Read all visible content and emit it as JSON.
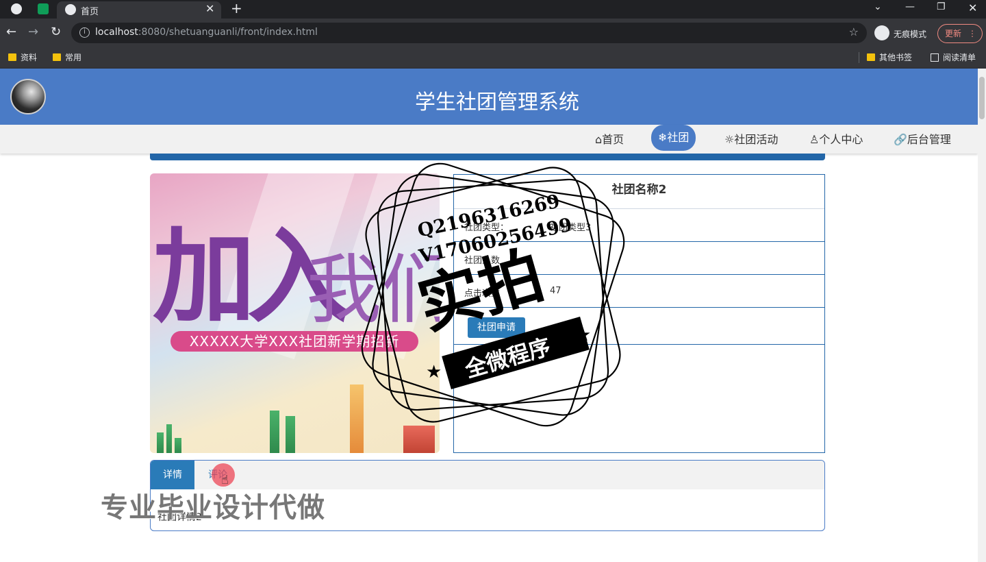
{
  "browser": {
    "tab_title": "首页",
    "url_host": "localhost",
    "url_rest": ":8080/shetuanguanli/front/index.html",
    "incognito_label": "无痕模式",
    "update_label": "更新",
    "bookmarks": [
      "资料",
      "常用"
    ],
    "bookmarks_right": [
      "其他书签",
      "阅读清单"
    ]
  },
  "site": {
    "title": "学生社团管理系统"
  },
  "nav": {
    "items": [
      {
        "icon": "home-icon",
        "label": "⌂首页"
      },
      {
        "icon": "snowflake-icon",
        "label": "❄社团"
      },
      {
        "icon": "activity-icon",
        "label": "☼社团活动"
      },
      {
        "icon": "user-icon",
        "label": "♙个人中心"
      },
      {
        "icon": "link-icon",
        "label": "🔗后台管理"
      }
    ],
    "active": "社团"
  },
  "banner": {
    "big_text": "加入",
    "small_text": "我们",
    "ribbon": "XXXXX大学XXX社团新学期招新"
  },
  "club": {
    "name": "社团名称2",
    "type_label": "社团类型：",
    "type_value": "社团类型3",
    "members_label": "社团人数",
    "views_label": "点击次数",
    "views_value": "47",
    "apply_label": "社团申请"
  },
  "detail": {
    "tab_detail": "详情",
    "tab_comment": "评论",
    "content": "社团详情2"
  },
  "overlay": {
    "qq": "Q2196316269",
    "v": "V17060256499",
    "shipai": "实拍",
    "ribbon": "全微程序",
    "watermark": "专业毕业设计代做"
  },
  "colors": {
    "header": "#4a7bc6",
    "accent": "#2a7bb8",
    "border": "#2366a8"
  }
}
